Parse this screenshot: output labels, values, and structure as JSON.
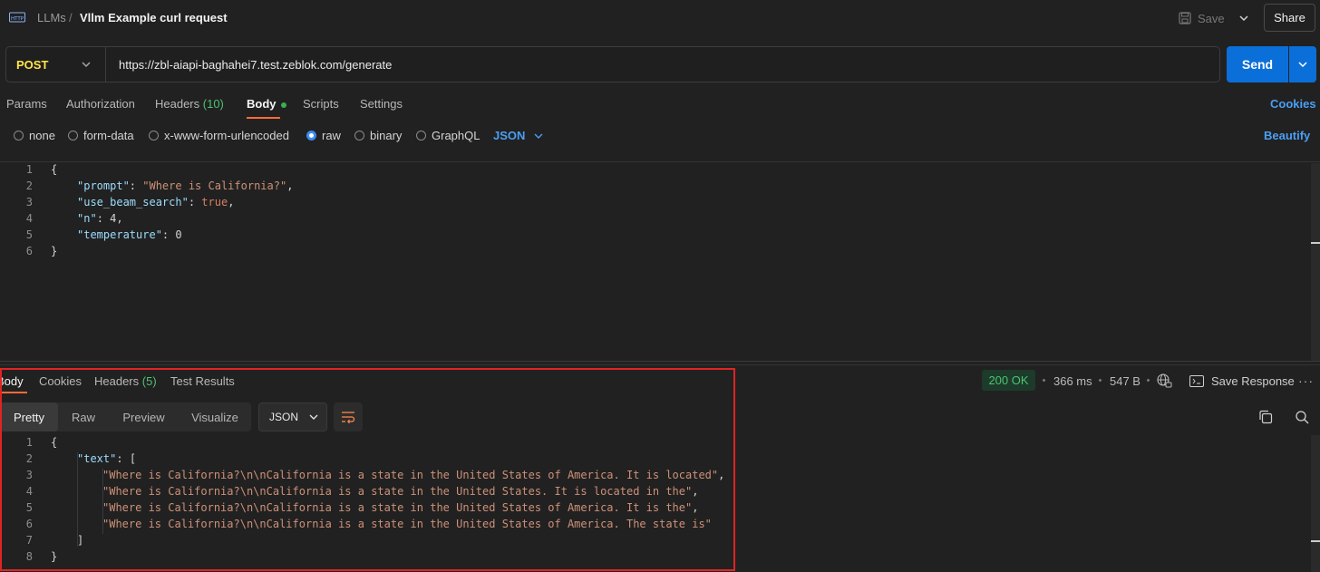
{
  "header": {
    "breadcrumb_parent": "LLMs",
    "breadcrumb_separator": "/",
    "title": "Vllm Example curl request",
    "save_label": "Save",
    "share_label": "Share"
  },
  "request": {
    "method": "POST",
    "url": "https://zbl-aiapi-baghahei7.test.zeblok.com/generate",
    "send_label": "Send",
    "tabs": {
      "params": "Params",
      "authorization": "Authorization",
      "headers": "Headers",
      "headers_count": "(10)",
      "body": "Body",
      "scripts": "Scripts",
      "settings": "Settings"
    },
    "active_tab": "Body",
    "cookies_label": "Cookies",
    "body_types": {
      "none": "none",
      "form_data": "form-data",
      "urlencoded": "x-www-form-urlencoded",
      "raw": "raw",
      "binary": "binary",
      "graphql": "GraphQL"
    },
    "selected_body_type": "raw",
    "raw_format": "JSON",
    "beautify_label": "Beautify",
    "line_numbers": [
      "1",
      "2",
      "3",
      "4",
      "5",
      "6"
    ],
    "body": {
      "open_brace": "{",
      "close_brace": "}",
      "prompt_key": "\"prompt\"",
      "prompt_value": "\"Where is California?\"",
      "beam_key": "\"use_beam_search\"",
      "beam_value": "true",
      "n_key": "\"n\"",
      "n_value": "4",
      "temperature_key": "\"temperature\"",
      "temperature_value": "0"
    }
  },
  "response": {
    "tabs": {
      "body": "Body",
      "cookies": "Cookies",
      "headers": "Headers",
      "headers_count": "(5)",
      "test_results": "Test Results"
    },
    "status": "200 OK",
    "time": "366 ms",
    "size": "547 B",
    "save_response_label": "Save Response",
    "views": {
      "pretty": "Pretty",
      "raw": "Raw",
      "preview": "Preview",
      "visualize": "Visualize"
    },
    "active_view": "Pretty",
    "format": "JSON",
    "line_numbers": [
      "1",
      "2",
      "3",
      "4",
      "5",
      "6",
      "7",
      "8"
    ],
    "body": {
      "open_brace": "{",
      "text_key": "\"text\"",
      "open_bracket": "[",
      "items": [
        "\"Where is California?\\n\\nCalifornia is a state in the United States of America. It is located\"",
        "\"Where is California?\\n\\nCalifornia is a state in the United States. It is located in the\"",
        "\"Where is California?\\n\\nCalifornia is a state in the United States of America. It is the\"",
        "\"Where is California?\\n\\nCalifornia is a state in the United States of America. The state is\""
      ],
      "close_bracket": "]",
      "close_brace": "}"
    }
  },
  "colors": {
    "accent_blue": "#0b6fd9",
    "method_yellow": "#ffe44c",
    "active_tab_orange": "#ff6c37",
    "status_green": "#4ec172",
    "highlight_red": "#e02424"
  },
  "icons": [
    "http-icon",
    "save-icon",
    "chevron-down-icon",
    "radio-icon",
    "globe-lock-icon",
    "save-response-icon",
    "more-icon",
    "wrap-lines-icon",
    "copy-icon",
    "search-icon"
  ]
}
